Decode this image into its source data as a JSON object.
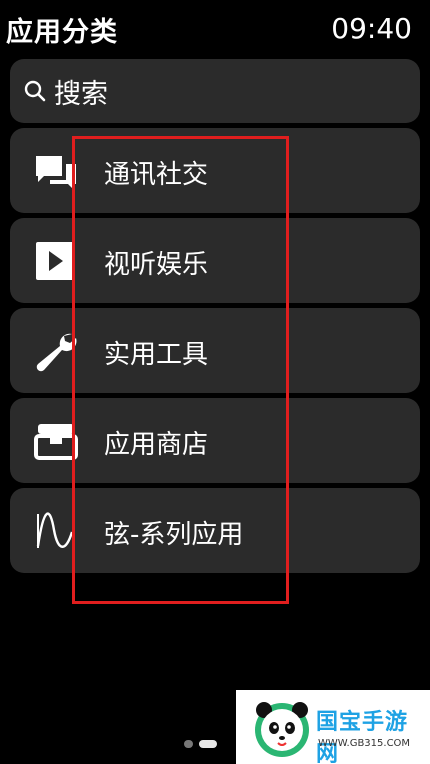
{
  "header": {
    "title": "应用分类",
    "time": "09:40"
  },
  "search": {
    "label": "搜索",
    "icon": "search-icon"
  },
  "categories": [
    {
      "label": "通讯社交",
      "icon": "chat-bubbles-icon"
    },
    {
      "label": "视听娱乐",
      "icon": "play-icon"
    },
    {
      "label": "实用工具",
      "icon": "wrench-icon"
    },
    {
      "label": "应用商店",
      "icon": "store-box-icon"
    },
    {
      "label": "弦-系列应用",
      "icon": "waveform-icon"
    }
  ],
  "pager": {
    "pages": 2,
    "current": 2
  },
  "watermark": {
    "brand": "国宝手游网",
    "url": "WWW.GB315.COM"
  },
  "colors": {
    "card": "#2b2b2b",
    "highlight": "#e01e1e",
    "brand": "#1ea2e4"
  }
}
